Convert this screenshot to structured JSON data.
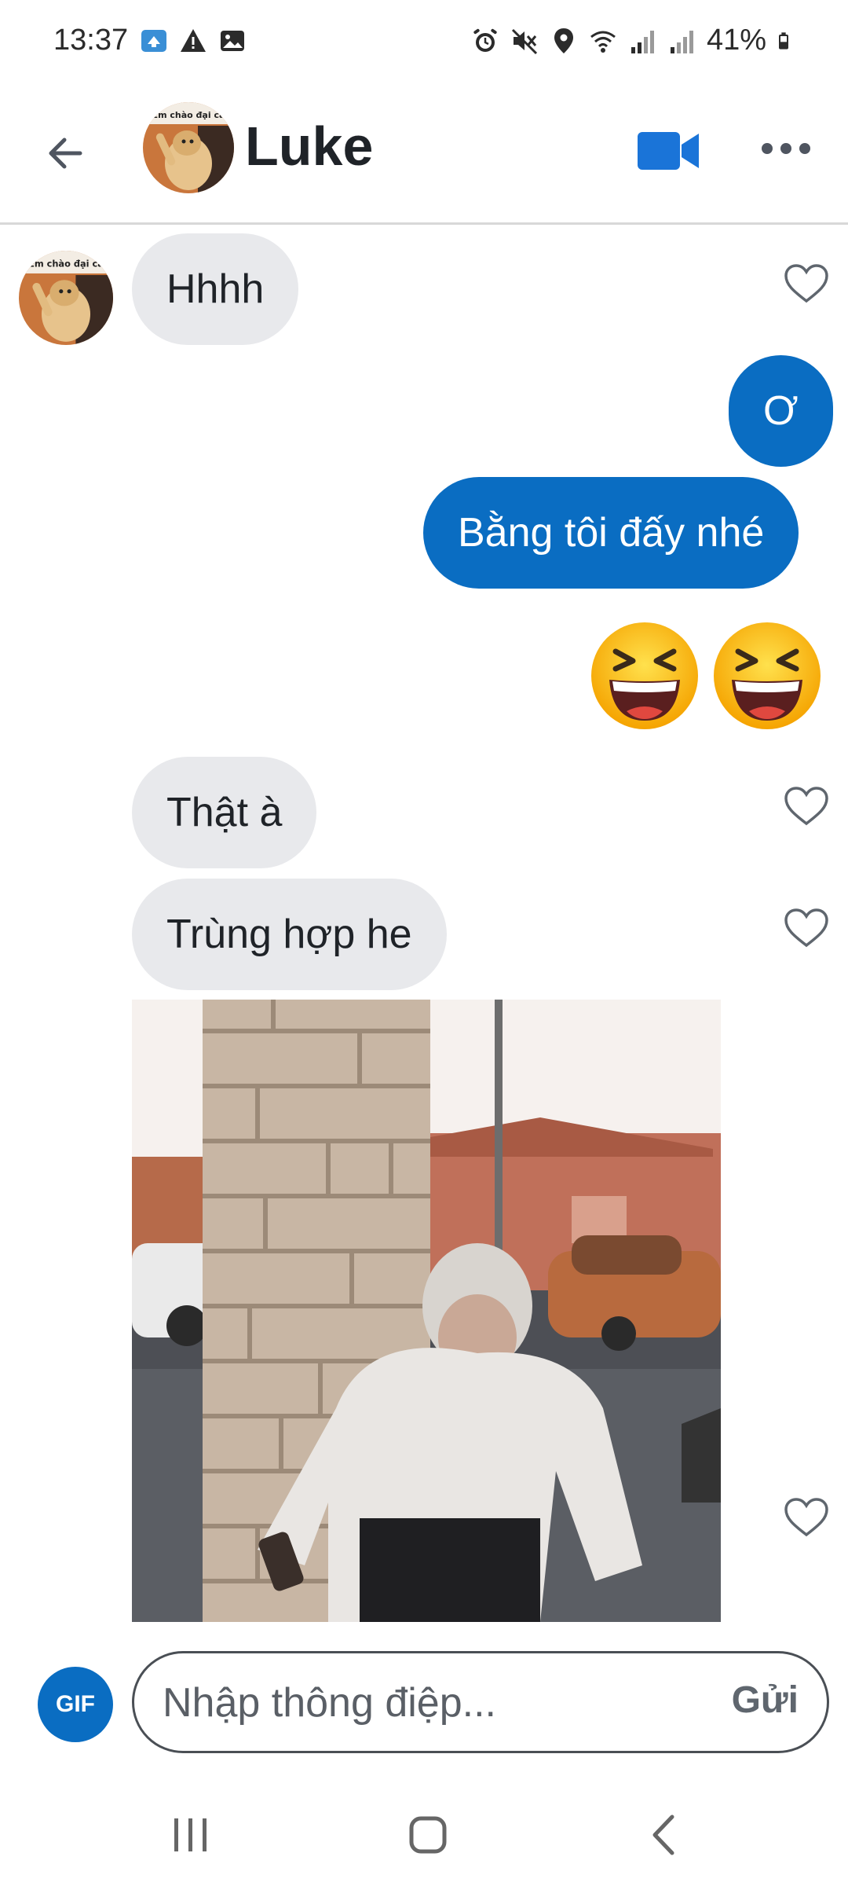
{
  "status_bar": {
    "time": "13:37",
    "battery": "41%"
  },
  "header": {
    "contact_name": "Luke",
    "avatar_caption": "Em chào đại ca"
  },
  "messages": [
    {
      "direction": "in",
      "text": "Hhhh"
    },
    {
      "direction": "out",
      "text": "Ơ"
    },
    {
      "direction": "out",
      "text": "Bằng tôi đấy nhé"
    },
    {
      "direction": "out",
      "type": "emoji",
      "emoji": "laughing-face-emoji",
      "count": 2
    },
    {
      "direction": "in",
      "text": "Thật à"
    },
    {
      "direction": "in",
      "text": "Trùng hợp he"
    },
    {
      "direction": "in",
      "type": "gif"
    }
  ],
  "composer": {
    "gif_label": "GIF",
    "placeholder": "Nhập thông điệp...",
    "send_label": "Gửi"
  },
  "colors": {
    "accent": "#0a6dc2",
    "incoming_bubble": "#e8e9ec",
    "outgoing_bubble": "#0a6dc2"
  }
}
